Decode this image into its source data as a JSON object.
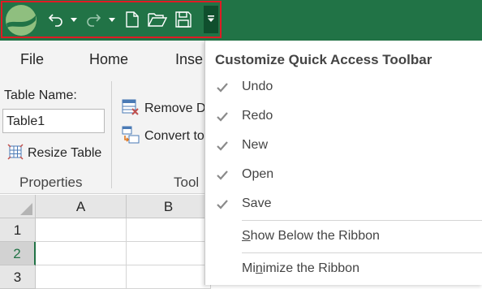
{
  "colors": {
    "title_bar": "#217346",
    "highlight_frame": "#e01b24",
    "menu_bg": "#ffffff",
    "ribbon_bg": "#f3f3f3"
  },
  "quick_access": {
    "icons": [
      "app-logo-icon",
      "undo-icon",
      "redo-icon",
      "new-file-icon",
      "open-folder-icon",
      "save-icon",
      "customize-dropdown-icon"
    ]
  },
  "tabs": [
    "File",
    "Home",
    "Inse"
  ],
  "ribbon": {
    "properties": {
      "table_name_label": "Table Name:",
      "table_name_value": "Table1",
      "resize_table_label": "Resize Table",
      "group_label": "Properties"
    },
    "tools": {
      "remove_label": "Remove D",
      "convert_label": "Convert to",
      "group_label": "Tool"
    }
  },
  "grid": {
    "columns": [
      "A",
      "B"
    ],
    "rows": [
      "1",
      "2",
      "3"
    ],
    "active_row": "2"
  },
  "menu": {
    "title": "Customize Quick Access Toolbar",
    "items": [
      {
        "label": "Undo",
        "checked": true
      },
      {
        "label": "Redo",
        "checked": true
      },
      {
        "label": "New",
        "checked": true
      },
      {
        "label": "Open",
        "checked": true
      },
      {
        "label": "Save",
        "checked": true
      }
    ],
    "show_below": {
      "mnemonic": "S",
      "rest": "how Below the Ribbon"
    },
    "minimize": {
      "before": "Mi",
      "mnemonic": "n",
      "after": "imize the Ribbon"
    }
  }
}
